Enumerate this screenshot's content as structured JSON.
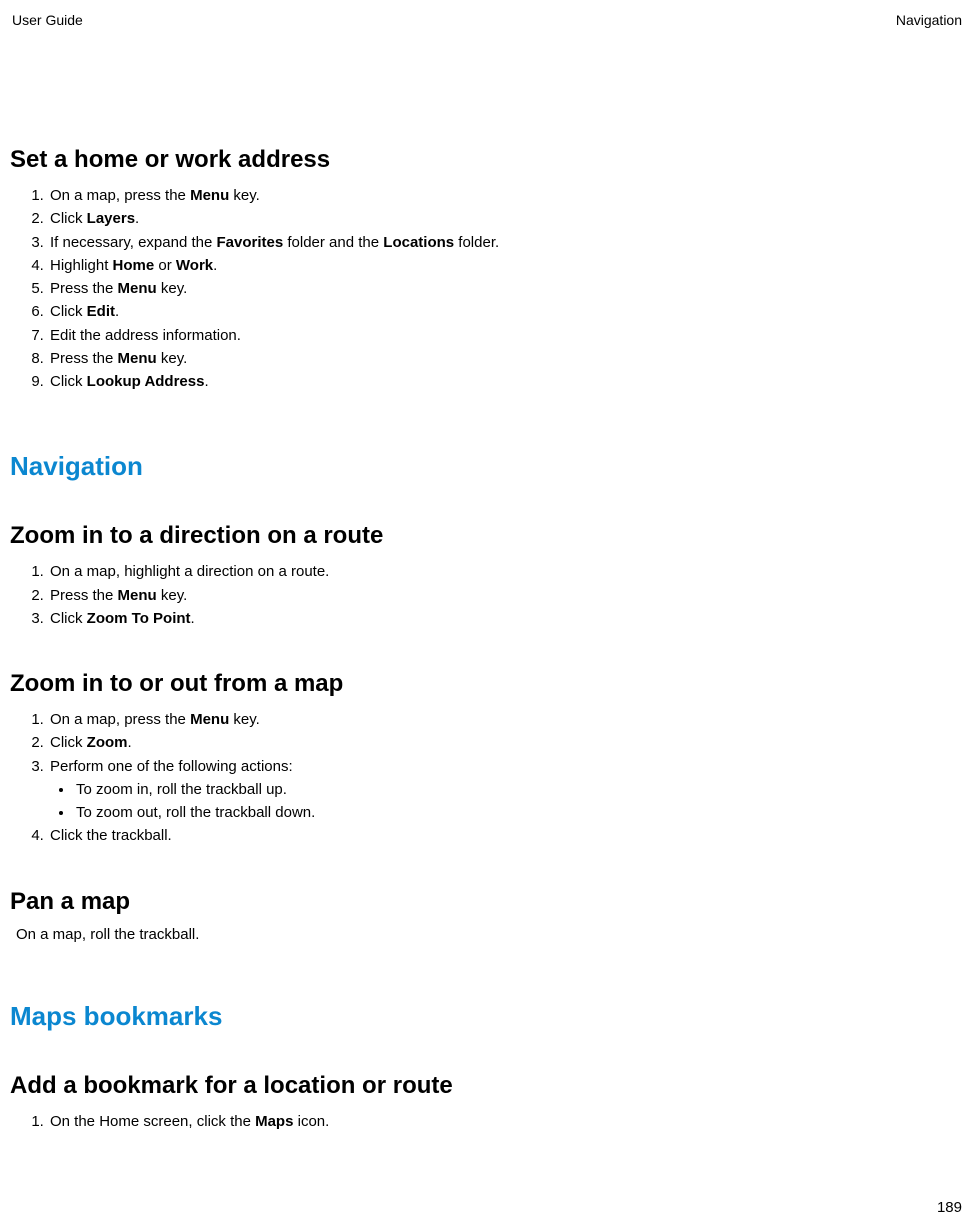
{
  "header": {
    "left": "User Guide",
    "right": "Navigation"
  },
  "page_number": "189",
  "sections": {
    "set_home": {
      "title": "Set a home or work address",
      "step1_a": "On a map, press the ",
      "step1_b": "Menu",
      "step1_c": " key.",
      "step2_a": "Click ",
      "step2_b": "Layers",
      "step2_c": ".",
      "step3_a": "If necessary, expand the ",
      "step3_b": "Favorites",
      "step3_c": " folder and the ",
      "step3_d": "Locations",
      "step3_e": " folder.",
      "step4_a": "Highlight ",
      "step4_b": "Home",
      "step4_c": " or ",
      "step4_d": "Work",
      "step4_e": ".",
      "step5_a": "Press the ",
      "step5_b": "Menu",
      "step5_c": " key.",
      "step6_a": "Click ",
      "step6_b": "Edit",
      "step6_c": ".",
      "step7": "Edit the address information.",
      "step8_a": "Press the ",
      "step8_b": "Menu",
      "step8_c": " key.",
      "step9_a": "Click ",
      "step9_b": "Lookup Address",
      "step9_c": "."
    },
    "navigation": {
      "title": "Navigation",
      "zoom_direction": {
        "title": "Zoom in to a direction on a route",
        "step1": "On a map, highlight a direction on a route.",
        "step2_a": "Press the ",
        "step2_b": "Menu",
        "step2_c": " key.",
        "step3_a": "Click ",
        "step3_b": "Zoom To Point",
        "step3_c": "."
      },
      "zoom_map": {
        "title": "Zoom in to or out from a map",
        "step1_a": "On a map, press the ",
        "step1_b": "Menu",
        "step1_c": " key.",
        "step2_a": "Click ",
        "step2_b": "Zoom",
        "step2_c": ".",
        "step3": "Perform one of the following actions:",
        "bullet1": "To zoom in, roll the trackball up.",
        "bullet2": "To zoom out, roll the trackball down.",
        "step4": "Click the trackball."
      },
      "pan_map": {
        "title": "Pan a map",
        "body": "On a map, roll the trackball."
      }
    },
    "bookmarks": {
      "title": "Maps bookmarks",
      "add_bookmark": {
        "title": "Add a bookmark for a location or route",
        "step1_a": "On the Home screen, click the ",
        "step1_b": "Maps",
        "step1_c": " icon."
      }
    }
  }
}
